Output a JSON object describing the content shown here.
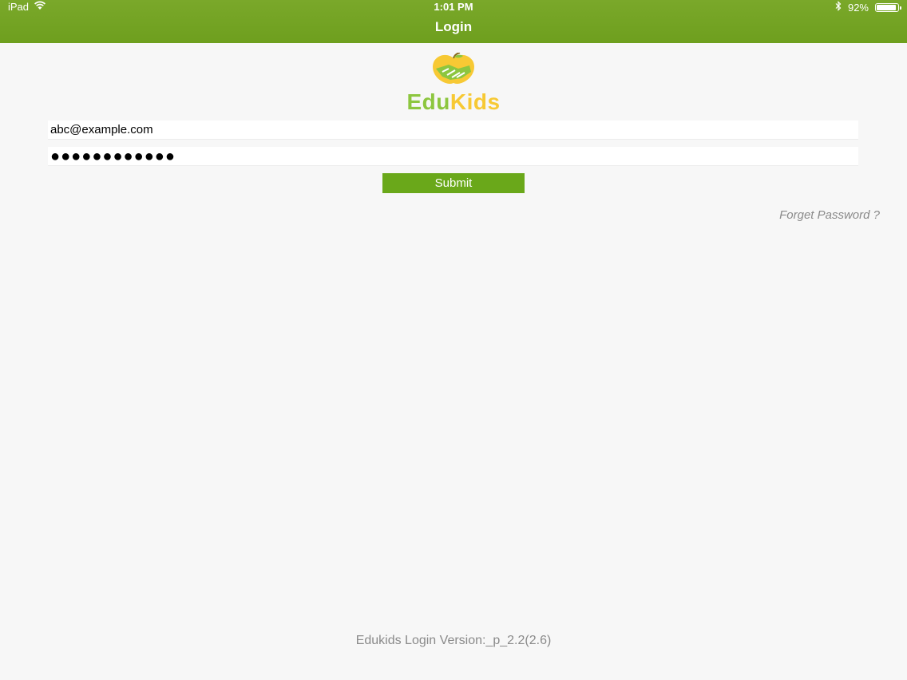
{
  "status_bar": {
    "device": "iPad",
    "time": "1:01 PM",
    "battery_text": "92%",
    "battery_level": 0.92,
    "icons": [
      "wifi-icon",
      "bluetooth-icon",
      "battery-icon"
    ]
  },
  "nav": {
    "title": "Login"
  },
  "logo": {
    "edu": "Edu",
    "kids": "Kids"
  },
  "form": {
    "email_value": "abc@example.com",
    "password_mask": "●●●●●●●●●●●●",
    "submit_label": "Submit"
  },
  "links": {
    "forgot_password": "Forget Password ?"
  },
  "footer": {
    "version": "Edukids Login Version:_p_2.2(2.6)"
  },
  "colors": {
    "header": "#7aa82a",
    "button": "#6aa81a",
    "logo_green": "#8dc63f",
    "logo_yellow": "#f7c934",
    "link_gray": "#8a8a8a"
  }
}
